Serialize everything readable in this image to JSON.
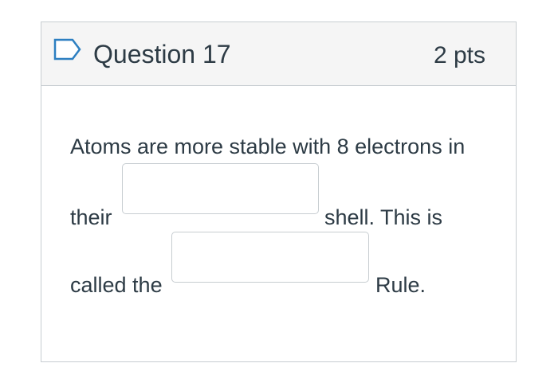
{
  "question": {
    "title": "Question 17",
    "points": "2 pts",
    "flag_icon": "bookmark-outline-icon",
    "accent_color": "#2d7fc1"
  },
  "body": {
    "line1": "Atoms are more stable with 8 electrons in",
    "line2_before": "their",
    "line2_after": "shell. This is",
    "line3_before": "called the",
    "line3_after": "Rule."
  },
  "blanks": [
    {
      "value": "",
      "placeholder": ""
    },
    {
      "value": "",
      "placeholder": ""
    }
  ]
}
